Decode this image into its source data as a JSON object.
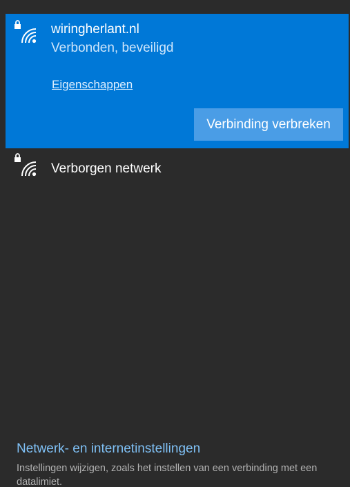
{
  "networks": {
    "connected": {
      "icon": "secured-wifi-icon",
      "name": "wiringherlant.nl",
      "status": "Verbonden, beveiligd",
      "properties_label": "Eigenschappen",
      "disconnect_label": "Verbinding verbreken"
    },
    "hidden": {
      "icon": "secured-wifi-icon",
      "name": "Verborgen netwerk"
    }
  },
  "footer": {
    "settings_link": "Netwerk- en internetinstellingen",
    "description": "Instellingen wijzigen, zoals het instellen van een verbinding met een datalimiet."
  },
  "colors": {
    "panel_bg": "#2b2b2b",
    "selected_bg": "#0078d7",
    "button_bg": "#4a9de6",
    "link_color": "#7fc0f5"
  }
}
